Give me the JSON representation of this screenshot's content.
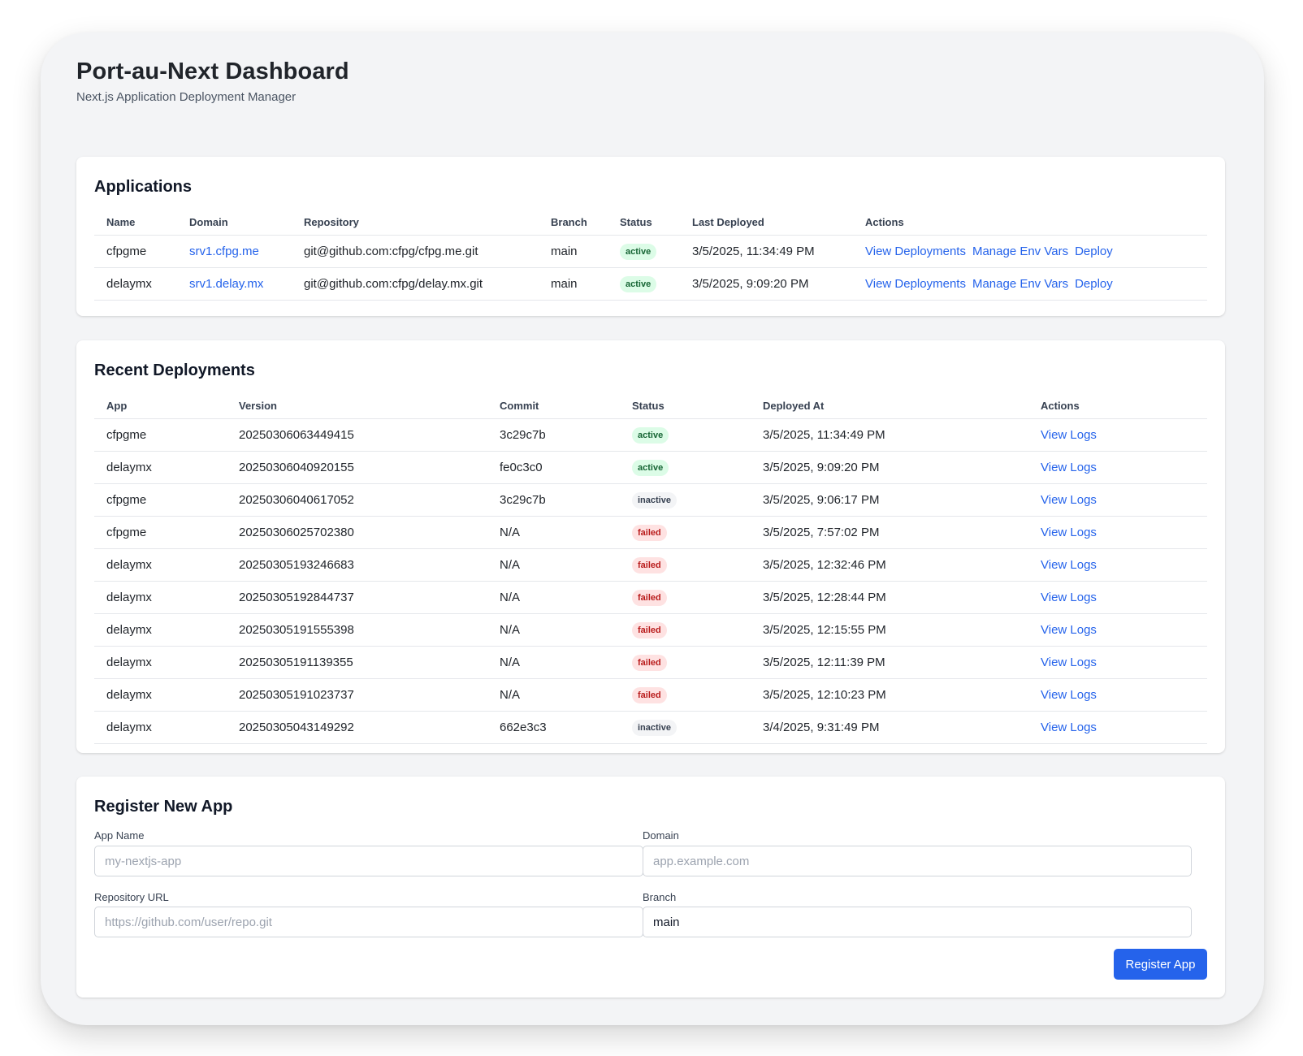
{
  "header": {
    "title": "Port-au-Next Dashboard",
    "subtitle": "Next.js Application Deployment Manager"
  },
  "applications": {
    "title": "Applications",
    "columns": [
      "Name",
      "Domain",
      "Repository",
      "Branch",
      "Status",
      "Last Deployed",
      "Actions"
    ],
    "rows": [
      {
        "name": "cfpgme",
        "domain": "srv1.cfpg.me",
        "repository": "git@github.com:cfpg/cfpg.me.git",
        "branch": "main",
        "status": "active",
        "last_deployed": "3/5/2025, 11:34:49 PM",
        "actions": [
          "View Deployments",
          "Manage Env Vars",
          "Deploy"
        ]
      },
      {
        "name": "delaymx",
        "domain": "srv1.delay.mx",
        "repository": "git@github.com:cfpg/delay.mx.git",
        "branch": "main",
        "status": "active",
        "last_deployed": "3/5/2025, 9:09:20 PM",
        "actions": [
          "View Deployments",
          "Manage Env Vars",
          "Deploy"
        ]
      }
    ]
  },
  "deployments": {
    "title": "Recent Deployments",
    "columns": [
      "App",
      "Version",
      "Commit",
      "Status",
      "Deployed At",
      "Actions"
    ],
    "rows": [
      {
        "app": "cfpgme",
        "version": "20250306063449415",
        "commit": "3c29c7b",
        "status": "active",
        "deployed_at": "3/5/2025, 11:34:49 PM",
        "action": "View Logs"
      },
      {
        "app": "delaymx",
        "version": "20250306040920155",
        "commit": "fe0c3c0",
        "status": "active",
        "deployed_at": "3/5/2025, 9:09:20 PM",
        "action": "View Logs"
      },
      {
        "app": "cfpgme",
        "version": "20250306040617052",
        "commit": "3c29c7b",
        "status": "inactive",
        "deployed_at": "3/5/2025, 9:06:17 PM",
        "action": "View Logs"
      },
      {
        "app": "cfpgme",
        "version": "20250306025702380",
        "commit": "N/A",
        "status": "failed",
        "deployed_at": "3/5/2025, 7:57:02 PM",
        "action": "View Logs"
      },
      {
        "app": "delaymx",
        "version": "20250305193246683",
        "commit": "N/A",
        "status": "failed",
        "deployed_at": "3/5/2025, 12:32:46 PM",
        "action": "View Logs"
      },
      {
        "app": "delaymx",
        "version": "20250305192844737",
        "commit": "N/A",
        "status": "failed",
        "deployed_at": "3/5/2025, 12:28:44 PM",
        "action": "View Logs"
      },
      {
        "app": "delaymx",
        "version": "20250305191555398",
        "commit": "N/A",
        "status": "failed",
        "deployed_at": "3/5/2025, 12:15:55 PM",
        "action": "View Logs"
      },
      {
        "app": "delaymx",
        "version": "20250305191139355",
        "commit": "N/A",
        "status": "failed",
        "deployed_at": "3/5/2025, 12:11:39 PM",
        "action": "View Logs"
      },
      {
        "app": "delaymx",
        "version": "20250305191023737",
        "commit": "N/A",
        "status": "failed",
        "deployed_at": "3/5/2025, 12:10:23 PM",
        "action": "View Logs"
      },
      {
        "app": "delaymx",
        "version": "20250305043149292",
        "commit": "662e3c3",
        "status": "inactive",
        "deployed_at": "3/4/2025, 9:31:49 PM",
        "action": "View Logs"
      }
    ]
  },
  "register": {
    "title": "Register New App",
    "app_name_label": "App Name",
    "app_name_placeholder": "my-nextjs-app",
    "domain_label": "Domain",
    "domain_placeholder": "app.example.com",
    "repo_label": "Repository URL",
    "repo_placeholder": "https://github.com/user/repo.git",
    "branch_label": "Branch",
    "branch_value": "main",
    "submit_label": "Register App"
  },
  "colors": {
    "accent": "#2563eb",
    "active_bg": "#dcfce7",
    "active_text": "#166534",
    "inactive_bg": "#f3f4f6",
    "inactive_text": "#374151",
    "failed_bg": "#fee2e2",
    "failed_text": "#b91c1c"
  }
}
